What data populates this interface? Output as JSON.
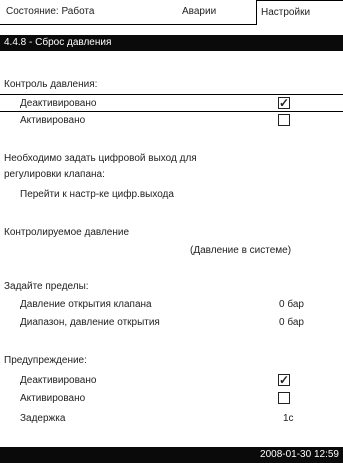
{
  "tabs": {
    "status": "Состояние: Работа",
    "alarm": "Аварии",
    "settings": "Настройки"
  },
  "screen_title": "4.4.8 - Сброс давления",
  "section_control": {
    "heading": "Контроль давления:",
    "options": [
      {
        "label": "Деактивировано",
        "checked": true
      },
      {
        "label": "Активировано",
        "checked": false
      }
    ]
  },
  "info_text": {
    "line1": "Необходимо задать цифровой выход для",
    "line2": "регулировки клапана:",
    "link": "Перейти к настр-ке цифр.выхода"
  },
  "controlled_pressure": {
    "heading": "Контролируемое давление",
    "value": "(Давление в системе)"
  },
  "limits": {
    "heading": "Задайте пределы:",
    "rows": [
      {
        "label": "Давление открытия клапана",
        "value": "0 бар"
      },
      {
        "label": "Диапазон, давление открытия",
        "value": "0 бар"
      }
    ]
  },
  "warning": {
    "heading": "Предупреждение:",
    "options": [
      {
        "label": "Деактивировано",
        "checked": true
      },
      {
        "label": "Активировано",
        "checked": false
      }
    ],
    "delay_label": "Задержка",
    "delay_value": "1с"
  },
  "footer": {
    "datetime": "2008-01-30 12:59"
  }
}
